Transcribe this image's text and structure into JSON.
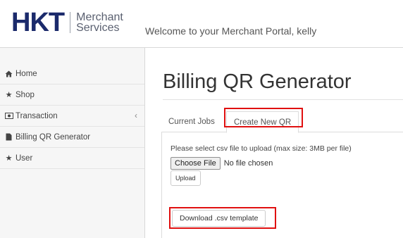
{
  "header": {
    "logo_text": "HKT",
    "logo_sub_line1": "Merchant",
    "logo_sub_line2": "Services",
    "welcome": "Welcome to your Merchant Portal, kelly"
  },
  "sidebar": {
    "items": [
      {
        "label": "Home",
        "icon": "home-icon"
      },
      {
        "label": "Shop",
        "icon": "star-icon"
      },
      {
        "label": "Transaction",
        "icon": "money-icon",
        "caret": "‹"
      },
      {
        "label": "Billing QR Generator",
        "icon": "document-icon"
      },
      {
        "label": "User",
        "icon": "star-icon"
      }
    ]
  },
  "main": {
    "title": "Billing QR Generator",
    "tabs": [
      {
        "label": "Current Jobs",
        "active": false
      },
      {
        "label": "Create New QR",
        "active": true
      }
    ],
    "upload": {
      "hint": "Please select csv file to upload (max size: 3MB per file)",
      "choose_label": "Choose File",
      "no_file": "No file chosen",
      "upload_label": "Upload"
    },
    "download_label": "Download .csv template"
  },
  "colors": {
    "highlight": "#e01010",
    "logo": "#1b2a6b"
  }
}
